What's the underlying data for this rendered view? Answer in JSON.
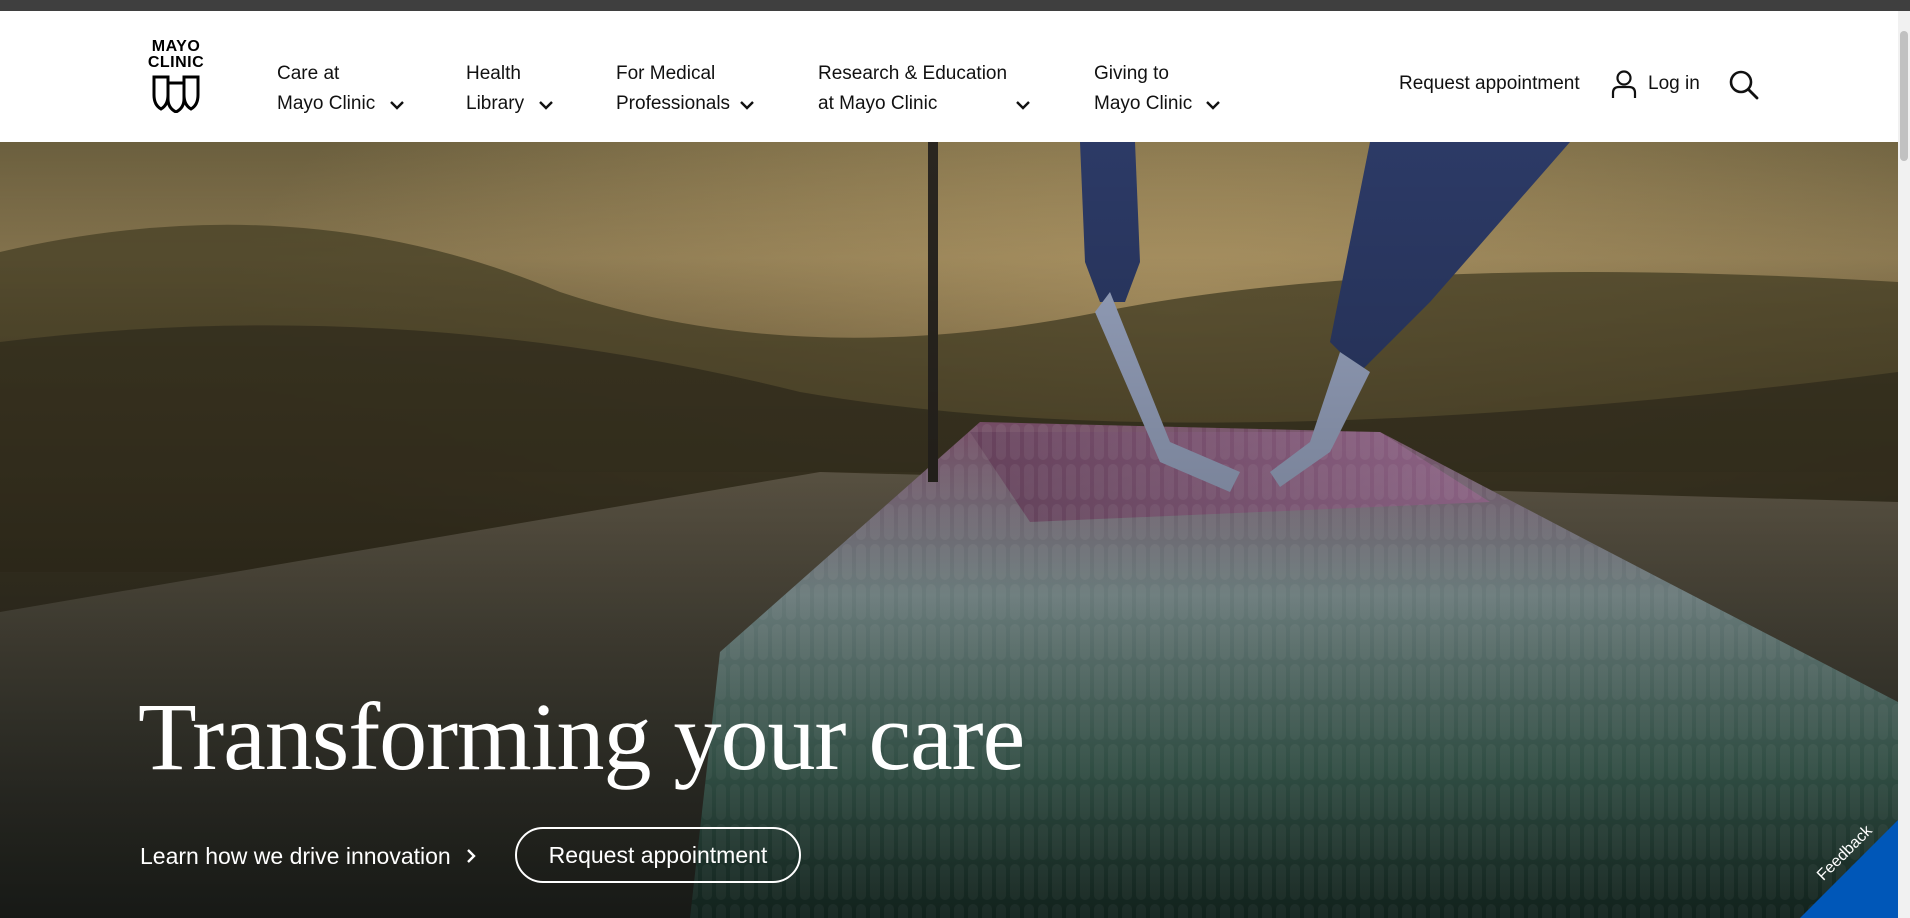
{
  "logo": {
    "line1": "MAYO",
    "line2": "CLINIC",
    "icon": "mayo-shields-icon"
  },
  "nav": {
    "items": [
      {
        "line1": "Care at",
        "line2": "Mayo Clinic",
        "icon": "chevron-down-icon"
      },
      {
        "line1": "Health",
        "line2": "Library",
        "icon": "chevron-down-icon"
      },
      {
        "line1": "For Medical",
        "line2": "Professionals",
        "icon": "chevron-down-icon"
      },
      {
        "line1": "Research & Education",
        "line2": "at Mayo Clinic",
        "icon": "chevron-down-icon"
      },
      {
        "line1": "Giving to",
        "line2": "Mayo Clinic",
        "icon": "chevron-down-icon"
      }
    ],
    "request_appointment": "Request appointment",
    "login": "Log in",
    "login_icon": "user-icon",
    "search_icon": "search-icon"
  },
  "hero": {
    "title": "Transforming your care",
    "learn_link": "Learn how we drive innovation",
    "learn_icon": "chevron-right-icon",
    "cta_button": "Request appointment"
  },
  "feedback": {
    "label": "Feedback",
    "color": "#0057b8"
  },
  "colors": {
    "topbar": "#3f3f3f",
    "header_bg": "#ffffff",
    "text": "#111111",
    "hero_text": "#ffffff"
  }
}
